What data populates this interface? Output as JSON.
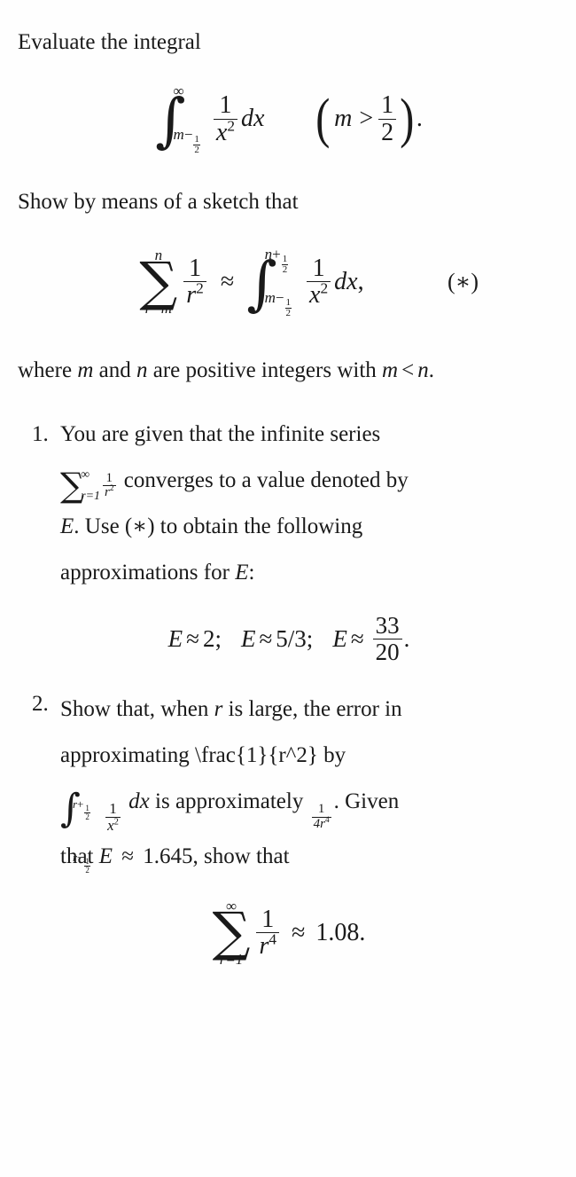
{
  "document": {
    "intro_line": "Evaluate the integral",
    "sketch_line": "Show by means of a sketch that",
    "where_line_a": "where",
    "where_line_b": "and",
    "where_line_c": "are positive integers with",
    "where_line_d": "."
  },
  "equation1": {
    "integral_sign": "∫",
    "upper_limit": "∞",
    "lower_limit_var": "m",
    "lower_limit_op": "−",
    "lower_limit_num": "1",
    "lower_limit_den": "2",
    "numerator": "1",
    "denominator_var": "x",
    "denominator_exp": "2",
    "differential": "dx",
    "condition_var": "m",
    "condition_op": ">",
    "condition_num": "1",
    "condition_den": "2",
    "trailing_punct": ".",
    "paren_open": "(",
    "paren_close": ")"
  },
  "equation2": {
    "sigma": "∑",
    "sum_upper": "n",
    "sum_lower": "r=m",
    "sum_num": "1",
    "sum_den_var": "r",
    "sum_den_exp": "2",
    "relation": "≈",
    "integral_sign": "∫",
    "int_upper_var": "n",
    "int_upper_op": "+",
    "int_upper_num": "1",
    "int_upper_den": "2",
    "int_lower_var": "m",
    "int_lower_op": "−",
    "int_lower_num": "1",
    "int_lower_den": "2",
    "numerator": "1",
    "denominator_var": "x",
    "denominator_exp": "2",
    "differential": "dx",
    "trailing_punct": ",",
    "tag": "(∗)"
  },
  "items": [
    {
      "number": "1.",
      "text_a": "You are given that the infinite series",
      "sum_sigma": "∑",
      "sum_upper": "∞",
      "sum_lower": "r=1",
      "sum_num": "1",
      "sum_den_var": "r",
      "sum_den_exp": "2",
      "text_b": "converges to a value denoted by",
      "var_E": "E",
      "text_c": ". Use (∗) to obtain the following",
      "text_d": "approximations for",
      "text_e": ":"
    },
    {
      "number": "2.",
      "text_a": "Show that, when",
      "var_r": "r",
      "text_b": "is large, the error in",
      "text_c": "approximating \\frac{1}{r^2} by",
      "int_sign": "∫",
      "int_upper_var": "r",
      "int_upper_op": "+",
      "int_upper_num": "1",
      "int_upper_den": "2",
      "int_lower_var": "r",
      "int_lower_op": "−",
      "int_lower_num": "1",
      "int_lower_den": "2",
      "int_num": "1",
      "int_den_var": "x",
      "int_den_exp": "2",
      "int_diff": "dx",
      "text_d": "is approximately",
      "err_num": "1",
      "err_den": "4r",
      "err_den_exp": "4",
      "text_e": ". Given",
      "text_f": "that",
      "var_E": "E",
      "approx_sign": "≈",
      "E_value": "1.645",
      "text_g": ", show that"
    }
  ],
  "equation3": {
    "var_E": "E",
    "approx": "≈",
    "value1": "2",
    "sep1": ";",
    "value2": "5/3",
    "sep2": ";",
    "value3_num": "33",
    "value3_den": "20",
    "trailing_punct": "."
  },
  "equation4": {
    "sigma": "∑",
    "sum_upper": "∞",
    "sum_lower": "r=1",
    "num": "1",
    "den_var": "r",
    "den_exp": "4",
    "approx": "≈",
    "value": "1.08",
    "trailing_punct": "."
  },
  "colors": {
    "background": "#fefefe",
    "text": "#1a1a1a"
  }
}
